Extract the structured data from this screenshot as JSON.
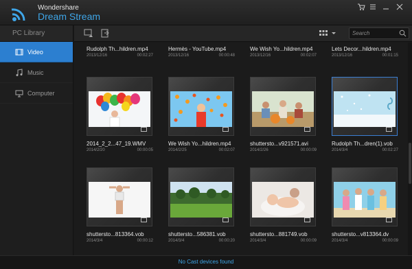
{
  "brand": {
    "company": "Wondershare",
    "product": "Dream Stream"
  },
  "sidebar": {
    "header": "PC Library",
    "items": [
      {
        "label": "Video",
        "icon": "film-icon",
        "active": true
      },
      {
        "label": "Music",
        "icon": "music-note-icon",
        "active": false
      },
      {
        "label": "Computer",
        "icon": "monitor-icon",
        "active": false
      }
    ]
  },
  "toolbar": {
    "search_placeholder": "Search"
  },
  "rows": [
    [
      {
        "name": "Rudolph Th...hildren.mp4",
        "date": "2013/12/16",
        "duration": "00:02:27"
      },
      {
        "name": "Hermès - YouTube.mp4",
        "date": "2013/12/16",
        "duration": "00:00:48"
      },
      {
        "name": "We Wish Yo...hildren.mp4",
        "date": "2013/12/16",
        "duration": "00:02:07"
      },
      {
        "name": "Lets Decor...hildren.mp4",
        "date": "2013/12/16",
        "duration": "00:01:15"
      }
    ],
    [
      {
        "name": "2014_2_2...47_19.WMV",
        "date": "2014/2/20",
        "duration": "00:00:05",
        "thumb": "balloons"
      },
      {
        "name": "We Wish Yo...hildren.mp4",
        "date": "2014/2/25",
        "duration": "00:02:07",
        "thumb": "leaves"
      },
      {
        "name": "shuttersto...v921571.avi",
        "date": "2014/2/26",
        "duration": "00:00:09",
        "thumb": "family"
      },
      {
        "name": "Rudolph Th...dren(1).vob",
        "date": "2014/3/4",
        "duration": "00:02:27",
        "thumb": "snow",
        "selected": true
      }
    ],
    [
      {
        "name": "shuttersto...813364.vob",
        "date": "2014/3/4",
        "duration": "00:00:12",
        "thumb": "fitness"
      },
      {
        "name": "shuttersto...586381.vob",
        "date": "2014/3/4",
        "duration": "00:00:20",
        "thumb": "park"
      },
      {
        "name": "shuttersto...881749.vob",
        "date": "2014/3/4",
        "duration": "00:00:09",
        "thumb": "baby"
      },
      {
        "name": "shuttersto...v813364.dv",
        "date": "2014/3/4",
        "duration": "00:00:09",
        "thumb": "friends"
      }
    ]
  ],
  "footer": {
    "status": "No Cast devices found"
  },
  "colors": {
    "accent": "#2c7fd0",
    "brand": "#3fa6e8",
    "background": "#1a1a1a"
  }
}
